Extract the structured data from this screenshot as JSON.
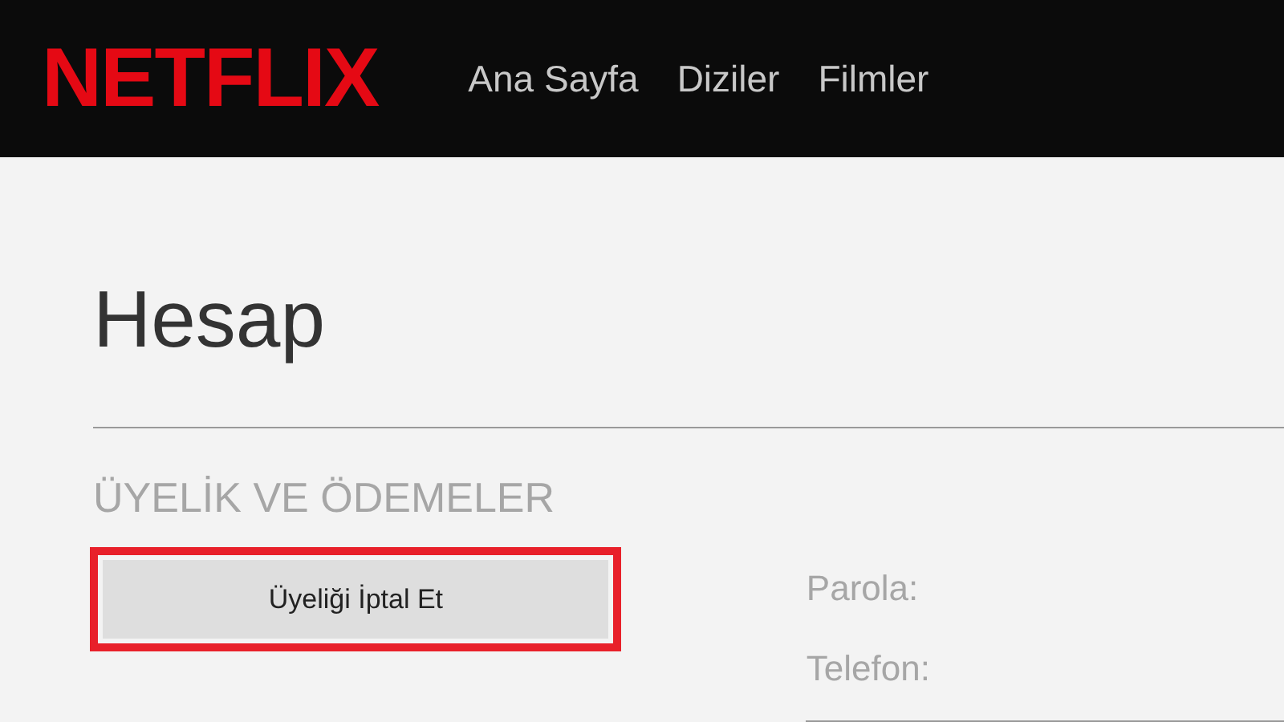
{
  "header": {
    "logo": "NETFLIX",
    "nav": [
      "Ana Sayfa",
      "Diziler",
      "Filmler"
    ]
  },
  "page": {
    "title": "Hesap"
  },
  "membership": {
    "heading": "ÜYELİK VE ÖDEMELER",
    "cancel_button": {
      "label": "Üyeliği İptal Et",
      "highlighted": true
    },
    "fields": [
      "Parola:",
      "Telefon:"
    ]
  }
}
